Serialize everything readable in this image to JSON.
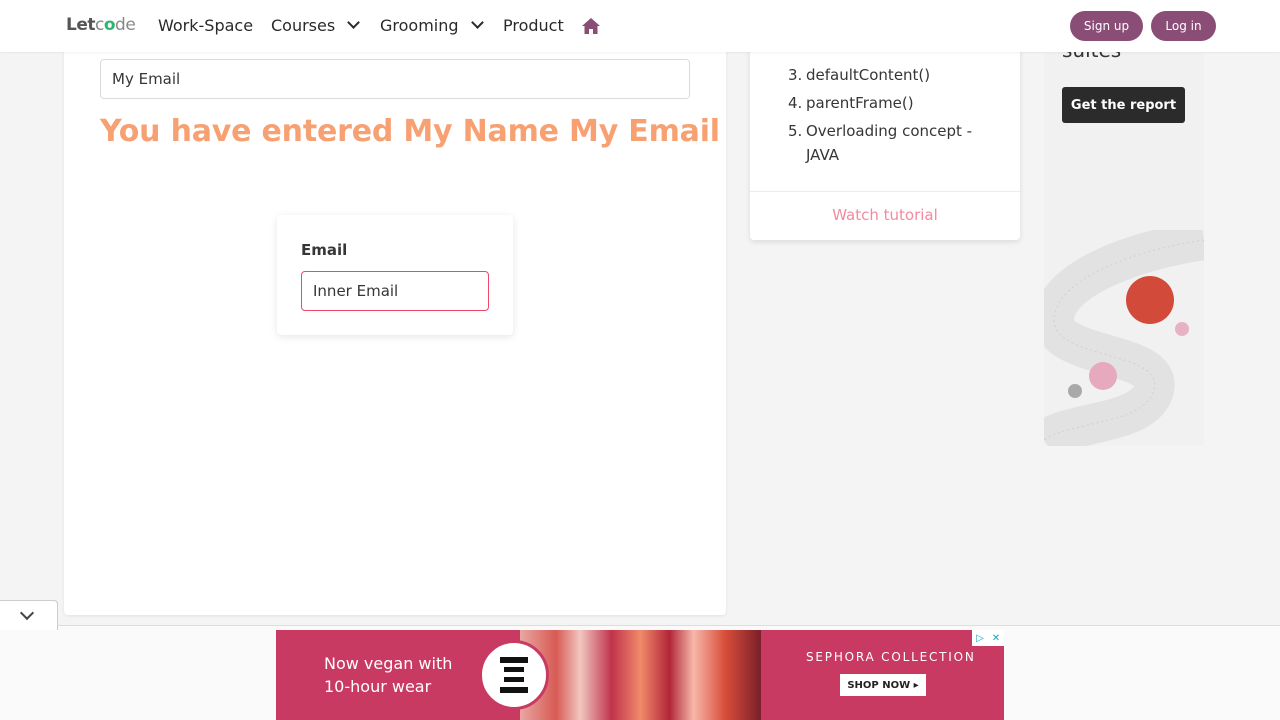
{
  "navbar": {
    "brand": {
      "part1": "Let",
      "part2": "c",
      "part3": "o",
      "part4": "de"
    },
    "items": [
      {
        "label": "Work-Space"
      },
      {
        "label": "Courses"
      },
      {
        "label": "Grooming"
      },
      {
        "label": "Product"
      }
    ],
    "signup_label": "Sign up",
    "login_label": "Log in",
    "accent": "#8a4d76"
  },
  "main": {
    "outer_input_value": "My Email",
    "result_text": "You have entered My Name My Email",
    "inner_frame": {
      "label": "Email",
      "input_value": "Inner Email"
    }
  },
  "side": {
    "items": [
      {
        "num": "3.",
        "text": "defaultContent()"
      },
      {
        "num": "4.",
        "text": "parentFrame()"
      },
      {
        "num": "5.",
        "text": "Overloading concept - JAVA"
      }
    ],
    "watch_link": "Watch tutorial"
  },
  "right_ad": {
    "headline": "suites",
    "button_label": "Get the report"
  },
  "bottom_ad": {
    "line1": "Now vegan with",
    "line2": "10-hour wear",
    "brand": "SEPHORA COLLECTION",
    "shop": "SHOP NOW ▸",
    "choice_icon": "▷",
    "close_icon": "✕"
  }
}
